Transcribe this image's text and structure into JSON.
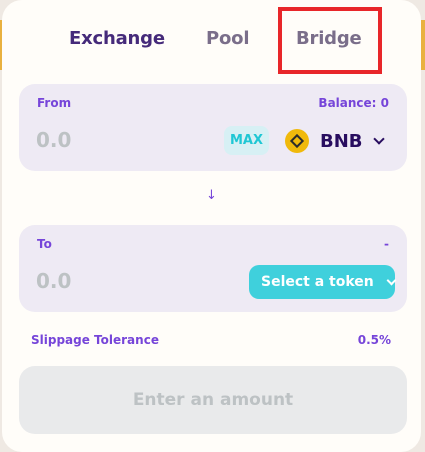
{
  "tabs": {
    "exchange": "Exchange",
    "pool": "Pool",
    "bridge": "Bridge"
  },
  "from": {
    "label": "From",
    "balance": "Balance: 0",
    "amount": "0.0",
    "max": "MAX",
    "token": "BNB",
    "token_icon": "bnb-logo-icon"
  },
  "arrow": "↓",
  "to": {
    "label": "To",
    "right": "-",
    "amount": "0.0",
    "select_token": "Select a token"
  },
  "slippage": {
    "label": "Slippage Tolerance",
    "value": "0.5%"
  },
  "action_button": "Enter an amount",
  "colors": {
    "accent_purple": "#7645d9",
    "dark_purple": "#280d5f",
    "cyan": "#1fc7d4",
    "highlight_red": "#e8262a",
    "bnb_yellow": "#f0b90b"
  }
}
